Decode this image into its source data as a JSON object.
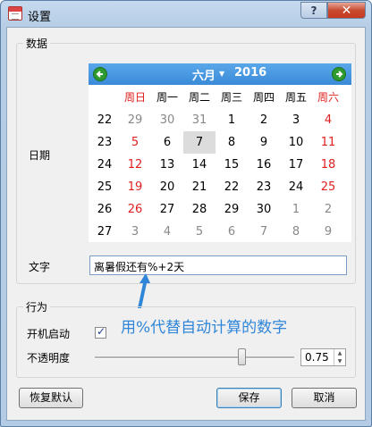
{
  "window": {
    "title": "设置",
    "help_label": "?",
    "close_label": "✕"
  },
  "data_group": {
    "title": "数据",
    "date_label": "日期",
    "text_label": "文字",
    "text_value": "离暑假还有%+2天"
  },
  "calendar": {
    "month": "六月",
    "year": "2016",
    "weekdays": [
      "周日",
      "周一",
      "周二",
      "周三",
      "周四",
      "周五",
      "周六"
    ],
    "weeks": [
      {
        "week": "22",
        "days": [
          "29",
          "30",
          "31",
          "1",
          "2",
          "3",
          "4"
        ]
      },
      {
        "week": "23",
        "days": [
          "5",
          "6",
          "7",
          "8",
          "9",
          "10",
          "11"
        ]
      },
      {
        "week": "24",
        "days": [
          "12",
          "13",
          "14",
          "15",
          "16",
          "17",
          "18"
        ]
      },
      {
        "week": "25",
        "days": [
          "19",
          "20",
          "21",
          "22",
          "23",
          "24",
          "25"
        ]
      },
      {
        "week": "26",
        "days": [
          "26",
          "27",
          "28",
          "29",
          "30",
          "1",
          "2"
        ]
      },
      {
        "week": "27",
        "days": [
          "3",
          "4",
          "5",
          "6",
          "7",
          "8",
          "9"
        ]
      }
    ],
    "selected_day": "7",
    "colors": {
      "header": "#3a8ad8",
      "weekend": "#e02020",
      "other_month": "#888888",
      "nav": "#2f9a2f"
    }
  },
  "callout_text": "用%代替自动计算的数字",
  "behavior_group": {
    "title": "行为",
    "autostart_label": "开机启动",
    "autostart_checked": true,
    "opacity_label": "不透明度",
    "opacity_value": "0.75",
    "opacity_slider_fraction": 0.75
  },
  "buttons": {
    "reset": "恢复默认",
    "save": "保存",
    "cancel": "取消"
  }
}
